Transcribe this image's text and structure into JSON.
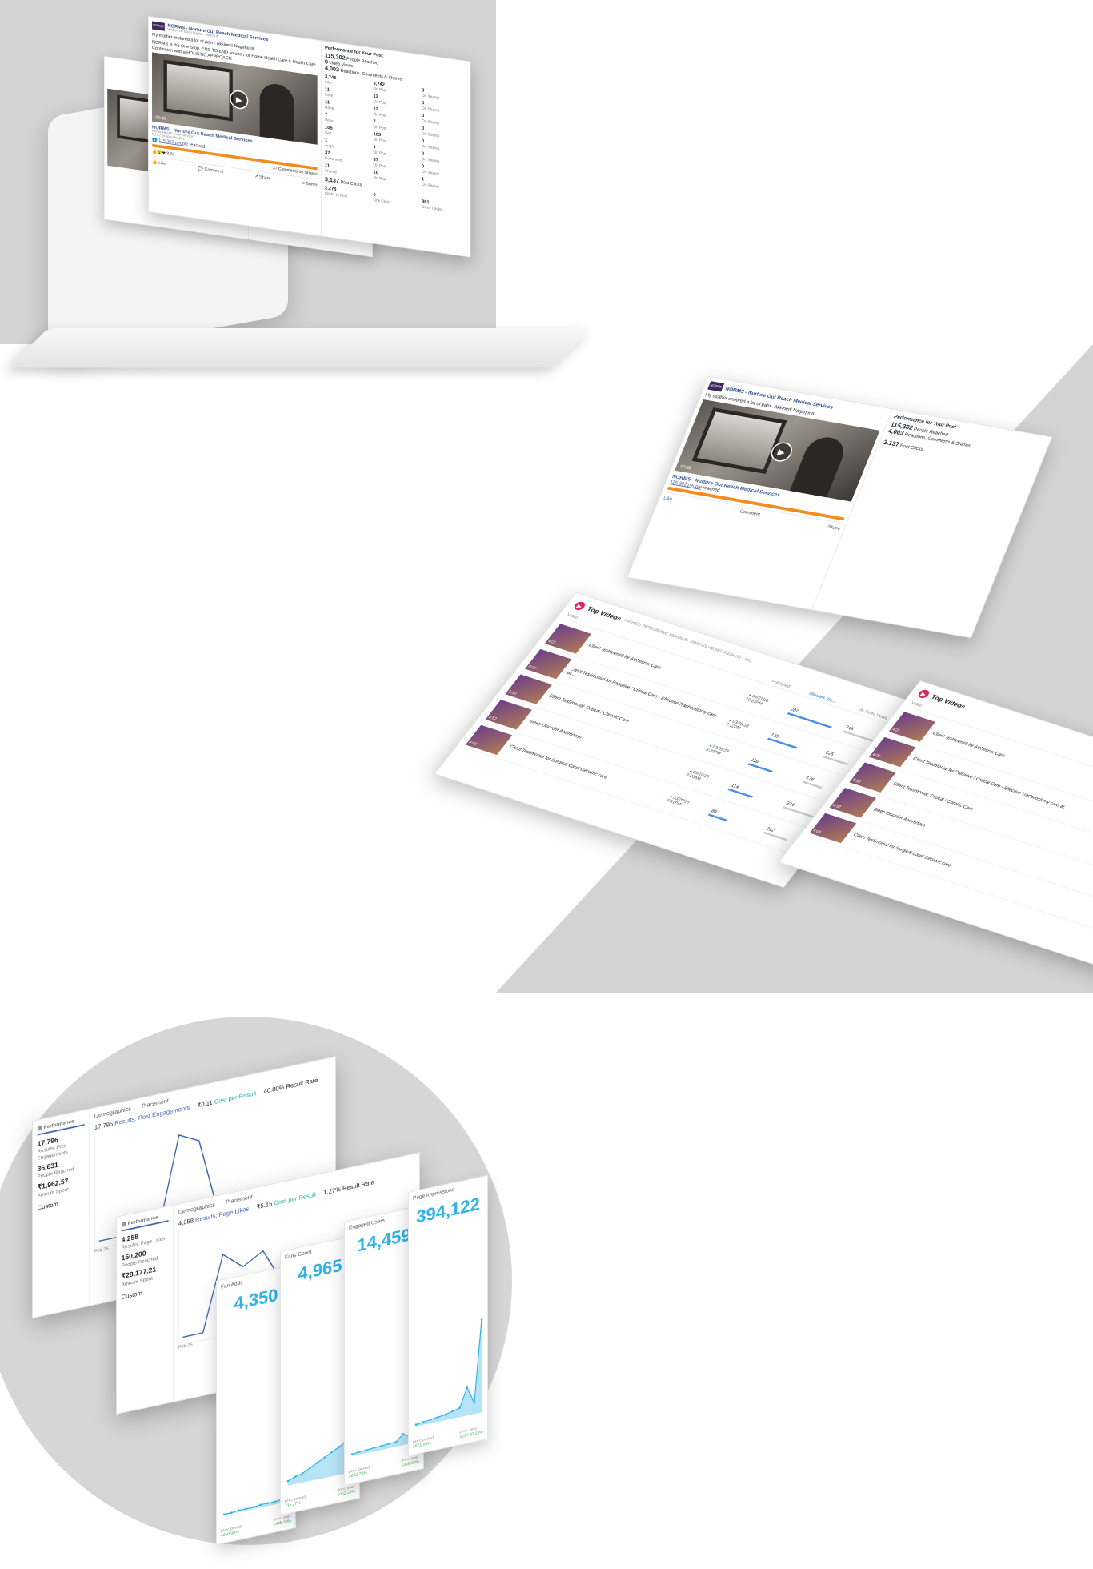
{
  "post": {
    "page_name": "NORMS - Nurture Out Reach Medical Services",
    "written_by": "Written by MVG Digital",
    "date": "March 4",
    "text1": "My mother endured a lot of pain - Akkineni Nagarjuna",
    "text2": "NORMS is the One Stop, END TO END solution for Home Health Care & Health Care Continuum with a HOLISTIC APPROACH",
    "video_duration": "02:38",
    "link_title": "NORMS - Nurture Out Reach Medical Services",
    "link_sub": "Home Health Care Service",
    "link_likes": "5,752 people like this",
    "reach_count": "115,302 people",
    "reach_suffix": "reached",
    "reactions_count": "3.7K",
    "comments_shares": "37 Comments  10 Shares",
    "like_label": "Like",
    "comment_label": "Comment",
    "share_label": "Share",
    "buffer_label": "Buffer"
  },
  "performance": {
    "title": "Performance for Your Post",
    "reached": "115,302",
    "reached_label": "People Reached",
    "views": "0",
    "views_label": "Video Views",
    "rcs": "4,003",
    "rcs_label": "Reactions, Comments & Shares",
    "rows": [
      [
        "3,745",
        "Like",
        "3,742",
        "On Post",
        "3",
        "On Shares"
      ],
      [
        "11",
        "Love",
        "11",
        "On Post",
        "0",
        "On Shares"
      ],
      [
        "11",
        "Haha",
        "11",
        "On Post",
        "0",
        "On Shares"
      ],
      [
        "7",
        "Wow",
        "7",
        "On Post",
        "0",
        "On Shares"
      ],
      [
        "105",
        "Sad",
        "105",
        "On Post",
        "0",
        "On Shares"
      ],
      [
        "1",
        "Angry",
        "1",
        "On Post",
        "0",
        "On Shares"
      ],
      [
        "37",
        "Comments",
        "37",
        "On Post",
        "0",
        "On Shares"
      ],
      [
        "11",
        "Shares",
        "10",
        "On Post",
        "1",
        "On Shares"
      ]
    ],
    "post_clicks": "3,137",
    "post_clicks_label": "Post Clicks",
    "clicks": [
      [
        "2,276",
        "Clicks to Play"
      ],
      [
        "0",
        "Link Clicks"
      ],
      [
        "861",
        "Other Clicks"
      ]
    ]
  },
  "top_videos": {
    "title": "Top Videos",
    "subtitle": "HIGHEST PERFORMING VIDEOS BY MINUTES VIEWED FROM 3/1 - 3/31",
    "col_video": "Video",
    "col_published": "Published",
    "col_minutes": "Minutes Vie...",
    "col_views": "3s Video Views",
    "rows": [
      {
        "dur": "4:21",
        "title": "Client Testimonial for Alzheimer Care",
        "date": "03/21/18",
        "time": "10:22PM",
        "minutes": "207",
        "views": "348"
      },
      {
        "dur": "4:02",
        "title": "Client Testimonial for Palliative / Critical Care - Effective Tracheostomy care at...",
        "date": "03/28/18",
        "time": "7:12PM",
        "minutes": "135",
        "views": "225"
      },
      {
        "dur": "5:33",
        "title": "Client Testimonial: Critical / Chronic Care",
        "date": "03/05/18",
        "time": "6:30PM",
        "minutes": "116",
        "views": "176"
      },
      {
        "dur": "2:52",
        "title": "Sleep Disorder Awareness",
        "date": "03/16/18",
        "time": "3:26AM",
        "minutes": "114",
        "views": "324"
      },
      {
        "dur": "4:02",
        "title": "Client Testimonial for Surgical Care/ Geriatric care",
        "date": "03/20/18",
        "time": "6:31PM",
        "minutes": "86",
        "views": "212"
      }
    ]
  },
  "ads1": {
    "tab_performance": "Performance",
    "tab_demographics": "Demographics",
    "tab_placement": "Placement",
    "results": "17,796",
    "results_label": "Results: Post Engagements",
    "cost": "₹0.11",
    "cost_label": "Cost per Result",
    "rate": "40.80%",
    "rate_label": "Result Rate",
    "reached": "36,631",
    "reached_label": "People Reached",
    "spent": "₹1,962.57",
    "spent_label": "Amount Spent",
    "custom": "Custom",
    "x_label": "Feb 25",
    "y_ticks": [
      "10K",
      "8K",
      "6K"
    ],
    "chart_data": {
      "type": "line",
      "values": [
        0,
        0,
        0,
        0,
        9,
        8,
        0,
        0,
        0,
        0,
        0,
        0
      ],
      "ylim": [
        0,
        10
      ]
    }
  },
  "ads2": {
    "tab_performance": "Performance",
    "tab_demographics": "Demographics",
    "tab_placement": "Placement",
    "results": "4,258",
    "results_label": "Results: Page Likes",
    "cost": "₹5.15",
    "cost_label": "Cost per Result",
    "rate": "1.27%",
    "rate_label": "Result Rate",
    "reached": "150,200",
    "reached_label": "People Reached",
    "spent": "₹28,177.21",
    "spent_label": "Amount Spent",
    "custom": "Custom",
    "x_label": "Feb 25",
    "y_ticks": [
      "600",
      "400",
      "200",
      "0"
    ],
    "chart_data": {
      "type": "line",
      "values": [
        0,
        1,
        450,
        350,
        420,
        200,
        380,
        300,
        320,
        0,
        310,
        280
      ],
      "ylim": [
        0,
        600
      ]
    }
  },
  "insights": [
    {
      "label": "Fan Adds",
      "value": "4,350",
      "foot_l": "prev. period",
      "foot_l2": "4350.00%",
      "foot_r": "prev. year",
      "foot_r2": "1445.00%",
      "chart_data": {
        "type": "line",
        "values": [
          1,
          1,
          2,
          2,
          2,
          3,
          3,
          3,
          4,
          100
        ]
      }
    },
    {
      "label": "Fans Count",
      "value": "4,965",
      "foot_l": "prev. period",
      "foot_l2": "715.27%",
      "foot_r": "prev. year",
      "foot_r2": "1052.20%",
      "chart_data": {
        "type": "area",
        "values": [
          5,
          8,
          10,
          14,
          18,
          22,
          26,
          30,
          35,
          100
        ]
      }
    },
    {
      "label": "Engaged Users",
      "value": "14,459",
      "foot_l": "prev. period",
      "foot_l2": "3032.73%",
      "foot_r": "prev. year",
      "foot_r2": "1308.03%",
      "chart_data": {
        "type": "line",
        "values": [
          2,
          3,
          3,
          4,
          4,
          5,
          5,
          12,
          8,
          100
        ]
      }
    },
    {
      "label": "Page Impressions",
      "value": "394,122",
      "foot_l": "prev. period",
      "foot_l2": "2871.15%",
      "foot_r": "prev. year",
      "foot_r2": "1237.37.20%",
      "chart_data": {
        "type": "line",
        "values": [
          2,
          3,
          4,
          5,
          6,
          8,
          10,
          30,
          12,
          100
        ]
      }
    }
  ]
}
